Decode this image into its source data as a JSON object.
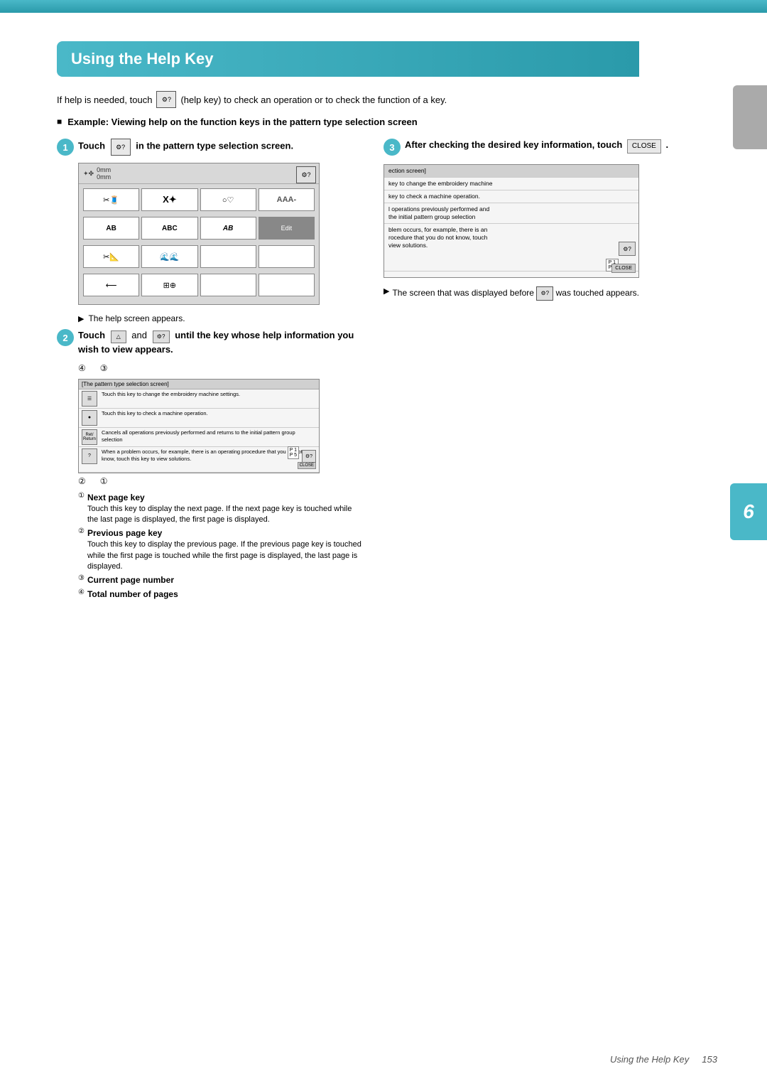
{
  "page": {
    "title": "Using the Help Key",
    "page_number": "153",
    "chapter": "6"
  },
  "intro": {
    "text_before": "If help is needed, touch",
    "text_after": "(help key) to check an operation or to check the function of a key."
  },
  "bold_intro": {
    "text": "Example: Viewing help on the function keys in the pattern type selection screen"
  },
  "step1": {
    "label": "1",
    "text": "Touch",
    "text_after": "in the pattern type selection screen.",
    "screen_indicator": "The help screen appears."
  },
  "step2": {
    "label": "2",
    "text": "Touch",
    "and_text": "and",
    "until_text": "until the key whose help information you wish to view appears.",
    "screen": {
      "header": "[The pattern type selection screen]",
      "rows": [
        {
          "icon": "☰",
          "text": "Touch this key to change the embroidery machine settings."
        },
        {
          "icon": "●",
          "text": "Touch this key to check a machine operation."
        },
        {
          "icon": "Ret/\nReturn",
          "text": "Cancels all operations previously performed and returns to the initial pattern group selection"
        },
        {
          "icon": "?",
          "text": "When a problem occurs, for example, there is an operating procedure that you do not know, touch this key to view solutions."
        }
      ],
      "page_indicator": "P 1\nP 5"
    },
    "nav_labels": {
      "num1": "④",
      "num2": "③"
    },
    "bottom_nav": {
      "num1": "②",
      "num2": "①"
    }
  },
  "numbered_items": [
    {
      "num": "①",
      "main": "Next page key",
      "desc": "Touch this key to display the next page. If the next page key is touched while the last page is displayed, the first page is displayed."
    },
    {
      "num": "②",
      "main": "Previous page key",
      "desc": "Touch this key to display the previous page. If the previous page key is touched while the first page is touched while the first page is displayed, the last page is displayed."
    },
    {
      "num": "③",
      "main": "Current page number"
    },
    {
      "num": "④",
      "main": "Total number of pages"
    }
  ],
  "step3": {
    "label": "3",
    "text": "After checking the desired key information, touch",
    "close_label": "CLOSE",
    "screen": {
      "rows": [
        "ection screen]",
        "key to change the embroidery machine",
        "key to check a machine operation.",
        "l operations previously performed and\nthe initial pattern group selection",
        "blem occurs, for example, there is an\nrocedure that you do not know, touch\nview solutions."
      ],
      "page_indicator": "P 1\nP 5",
      "close_btn": "CLOSE"
    },
    "note": "The screen that was displayed before",
    "note_after": "was touched appears."
  },
  "footer": {
    "text": "Using the Help Key",
    "page": "153"
  }
}
